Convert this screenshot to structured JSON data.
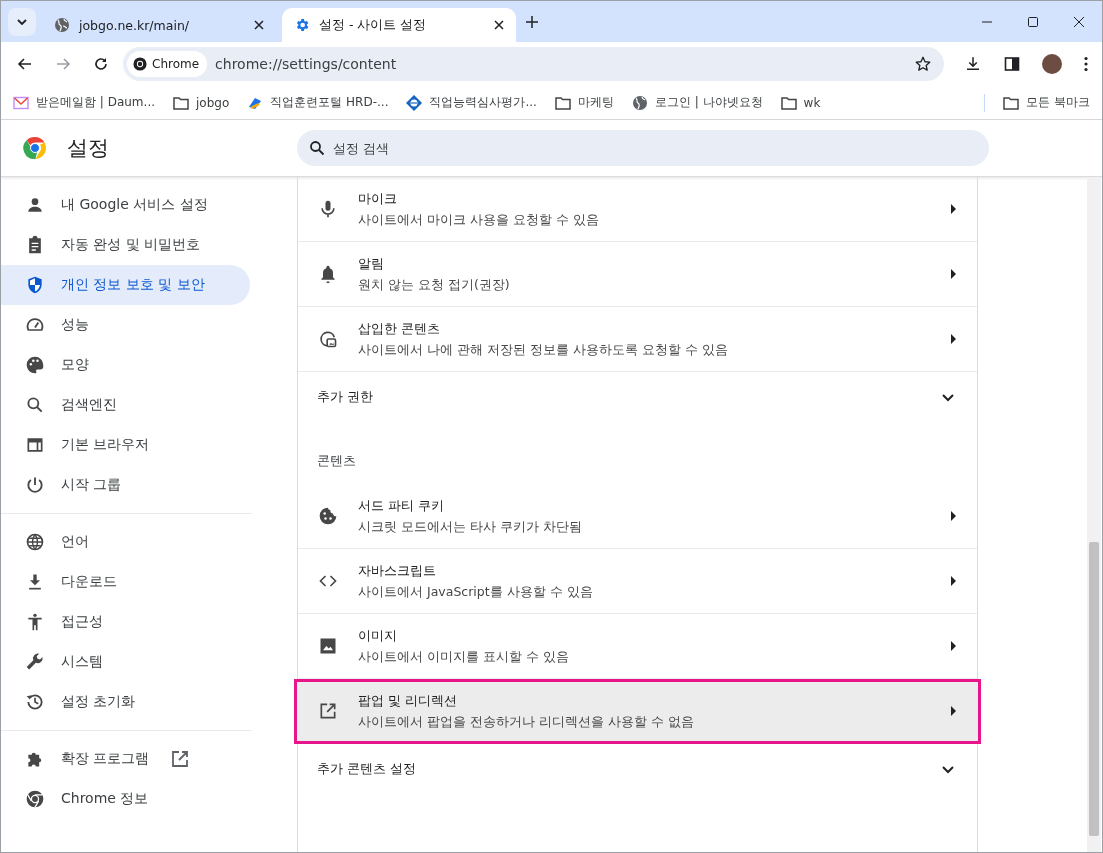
{
  "tabs": [
    {
      "title": "jobgo.ne.kr/main/",
      "selected": false
    },
    {
      "title": "설정 - 사이트 설정",
      "selected": true
    }
  ],
  "toolbar": {
    "chip": "Chrome",
    "url": "chrome://settings/content"
  },
  "bookmarks": [
    {
      "kind": "site",
      "label": "받은메일함 | Daum..."
    },
    {
      "kind": "folder",
      "label": "jobgo"
    },
    {
      "kind": "site",
      "label": "직업훈련포털 HRD-..."
    },
    {
      "kind": "site",
      "label": "직업능력심사평가..."
    },
    {
      "kind": "folder",
      "label": "마케팅"
    },
    {
      "kind": "site",
      "label": "로그인 | 나야넷요청"
    },
    {
      "kind": "folder",
      "label": "wk"
    }
  ],
  "all_bookmarks": "모든 북마크",
  "settings": {
    "title": "설정",
    "search_placeholder": "설정 검색"
  },
  "sidebar": {
    "groups": [
      [
        {
          "label": "내 Google 서비스 설정",
          "selected": false
        },
        {
          "label": "자동 완성 및 비밀번호",
          "selected": false
        },
        {
          "label": "개인 정보 보호 및 보안",
          "selected": true
        },
        {
          "label": "성능",
          "selected": false
        },
        {
          "label": "모양",
          "selected": false
        },
        {
          "label": "검색엔진",
          "selected": false
        },
        {
          "label": "기본 브라우저",
          "selected": false
        },
        {
          "label": "시작 그룹",
          "selected": false
        }
      ],
      [
        {
          "label": "언어",
          "selected": false
        },
        {
          "label": "다운로드",
          "selected": false
        },
        {
          "label": "접근성",
          "selected": false
        },
        {
          "label": "시스템",
          "selected": false
        },
        {
          "label": "설정 초기화",
          "selected": false
        }
      ],
      [
        {
          "label": "확장 프로그램",
          "selected": false
        },
        {
          "label": "Chrome 정보",
          "selected": false
        }
      ]
    ]
  },
  "content": [
    {
      "kind": "row",
      "title": "마이크",
      "subtitle": "사이트에서 마이크 사용을 요청할 수 있음",
      "highlighted": false
    },
    {
      "kind": "row",
      "title": "알림",
      "subtitle": "원치 않는 요청 접기(권장)",
      "highlighted": false
    },
    {
      "kind": "row",
      "title": "삽입한 콘텐츠",
      "subtitle": "사이트에서 나에 관해 저장된 정보를 사용하도록 요청할 수 있음",
      "highlighted": false
    },
    {
      "kind": "expander",
      "title": "추가 권한",
      "expanded": false
    },
    {
      "kind": "heading",
      "title": "콘텐츠"
    },
    {
      "kind": "row",
      "title": "서드 파티 쿠키",
      "subtitle": "시크릿 모드에서는 타사 쿠키가 차단됨",
      "highlighted": false
    },
    {
      "kind": "row",
      "title": "자바스크립트",
      "subtitle": "사이트에서 JavaScript를 사용할 수 있음",
      "highlighted": false
    },
    {
      "kind": "row",
      "title": "이미지",
      "subtitle": "사이트에서 이미지를 표시할 수 있음",
      "highlighted": false
    },
    {
      "kind": "row",
      "title": "팝업 및 리디렉션",
      "subtitle": "사이트에서 팝업을 전송하거나 리디렉션을 사용할 수 없음",
      "highlighted": true
    },
    {
      "kind": "expander",
      "title": "추가 콘텐츠 설정",
      "expanded": false
    }
  ]
}
